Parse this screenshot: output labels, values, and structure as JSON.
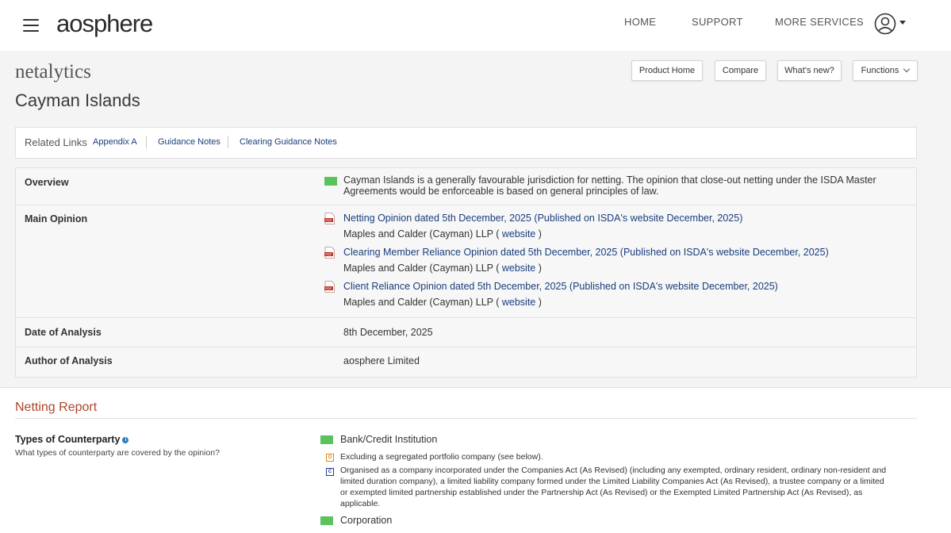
{
  "header": {
    "logo": "aosphere",
    "nav": [
      "HOME",
      "SUPPORT",
      "MORE SERVICES"
    ]
  },
  "product": {
    "name": "netalytics",
    "title": "Cayman Islands",
    "buttons": [
      "Product Home",
      "Compare",
      "What's new?",
      "Functions"
    ]
  },
  "related": {
    "label": "Related Links",
    "links": [
      "Appendix A",
      "Guidance Notes",
      "Clearing Guidance Notes"
    ]
  },
  "info": {
    "overview_label": "Overview",
    "overview_line1": "Cayman Islands is a generally favourable jurisdiction for netting. The opinion that close-out netting under the ISDA Master",
    "overview_line2": "Agreements would be enforceable is based on general principles of law.",
    "main_label": "Main Opinion",
    "opinions": [
      {
        "title": "Netting Opinion dated 5th December, 2025 (Published on ISDA's website December, 2025)",
        "firm": "Maples and Calder (Cayman) LLP (",
        "link": "website",
        "close": ")"
      },
      {
        "title": "Clearing Member Reliance Opinion dated 5th December, 2025 (Published on ISDA's website December, 2025)",
        "firm": "Maples and Calder (Cayman) LLP (",
        "link": "website",
        "close": ")"
      },
      {
        "title": "Client Reliance Opinion dated 5th December, 2025 (Published on ISDA's website December, 2025)",
        "firm": "Maples and Calder (Cayman) LLP (",
        "link": "website",
        "close": ")"
      }
    ],
    "date_label": "Date of Analysis",
    "date_value": "8th December, 2025",
    "author_label": "Author of Analysis",
    "author_value": "aosphere Limited"
  },
  "report": {
    "title": "Netting Report",
    "question": "Types of Counterparty",
    "question_sub": "What types of counterparty are covered by the opinion?",
    "cat1": "Bank/Credit Institution",
    "badge_o": "O",
    "badge_c": "C",
    "note_o": "Excluding a segregated portfolio company (see below).",
    "note_c1": "Organised as a company incorporated under the Companies Act (As Revised) (including any exempted, ordinary resident, ordinary non-resident and",
    "note_c2": "limited duration company), a limited liability company formed under the Limited Liability Companies Act (As Revised), a trustee company or a limited",
    "note_c3": "or exempted limited partnership established under the Partnership Act (As Revised) or the Exempted Limited Partnership Act (As Revised), as",
    "note_c4": "applicable.",
    "cat2": "Corporation"
  },
  "colors": {
    "favourable": "#5cc25e",
    "link": "#1a3d7c",
    "section_title": "#b0452a",
    "badge_o": "#e08a1e",
    "badge_c": "#1b3e8c"
  }
}
